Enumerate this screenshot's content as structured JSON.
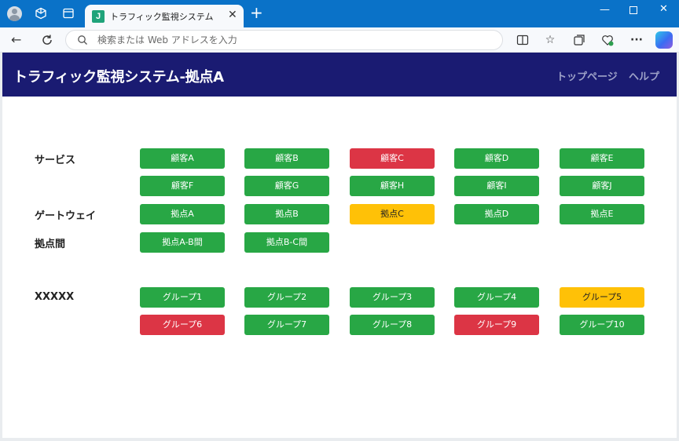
{
  "browser": {
    "tab_title": "トラフィック監視システム",
    "tab_favicon_letter": "J",
    "address_placeholder": "検索または Web アドレスを入力"
  },
  "header": {
    "title": "トラフィック監視システム-拠点A",
    "nav": [
      "トップページ",
      "ヘルプ"
    ],
    "bg_color": "#1a1b72"
  },
  "status_colors": {
    "ok": "#28a745",
    "error": "#dc3545",
    "warning": "#ffc107"
  },
  "sections": [
    {
      "label": "サービス",
      "rows": [
        [
          {
            "label": "顧客A",
            "status": "ok"
          },
          {
            "label": "顧客B",
            "status": "ok"
          },
          {
            "label": "顧客C",
            "status": "error"
          },
          {
            "label": "顧客D",
            "status": "ok"
          },
          {
            "label": "顧客E",
            "status": "ok"
          }
        ],
        [
          {
            "label": "顧客F",
            "status": "ok"
          },
          {
            "label": "顧客G",
            "status": "ok"
          },
          {
            "label": "顧客H",
            "status": "ok"
          },
          {
            "label": "顧客I",
            "status": "ok"
          },
          {
            "label": "顧客J",
            "status": "ok"
          }
        ]
      ]
    },
    {
      "label": "ゲートウェイ",
      "rows": [
        [
          {
            "label": "拠点A",
            "status": "ok"
          },
          {
            "label": "拠点B",
            "status": "ok"
          },
          {
            "label": "拠点C",
            "status": "warning"
          },
          {
            "label": "拠点D",
            "status": "ok"
          },
          {
            "label": "拠点E",
            "status": "ok"
          }
        ]
      ]
    },
    {
      "label": "拠点間",
      "rows": [
        [
          {
            "label": "拠点A-B間",
            "status": "ok"
          },
          {
            "label": "拠点B-C間",
            "status": "ok"
          }
        ]
      ]
    },
    {
      "label": "XXXXX",
      "rows": [
        [
          {
            "label": "グループ1",
            "status": "ok"
          },
          {
            "label": "グループ2",
            "status": "ok"
          },
          {
            "label": "グループ3",
            "status": "ok"
          },
          {
            "label": "グループ4",
            "status": "ok"
          },
          {
            "label": "グループ5",
            "status": "warning"
          }
        ],
        [
          {
            "label": "グループ6",
            "status": "error"
          },
          {
            "label": "グループ7",
            "status": "ok"
          },
          {
            "label": "グループ8",
            "status": "ok"
          },
          {
            "label": "グループ9",
            "status": "error"
          },
          {
            "label": "グループ10",
            "status": "ok"
          }
        ]
      ]
    }
  ]
}
